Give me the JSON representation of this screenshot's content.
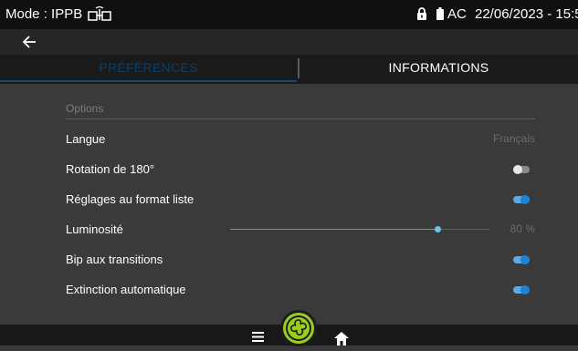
{
  "status_bar": {
    "mode_label": "Mode : IPPB",
    "power_label": "AC",
    "datetime": "22/06/2023 - 15:5",
    "icons": [
      "mode-device-icon",
      "lock-icon",
      "battery-icon"
    ]
  },
  "nav": {
    "back_icon": "back-arrow-icon"
  },
  "tabs": [
    {
      "label": "PRÉFÉRENCES",
      "active": true
    },
    {
      "label": "INFORMATIONS",
      "active": false
    }
  ],
  "options": {
    "section_title": "Options",
    "rows": [
      {
        "label": "Langue",
        "value": "Français",
        "kind": "value"
      },
      {
        "label": "Rotation de 180°",
        "kind": "toggle",
        "on": false
      },
      {
        "label": "Réglages au format liste",
        "kind": "toggle",
        "on": true
      },
      {
        "label": "Luminosité",
        "kind": "slider",
        "value": 80,
        "value_label": "80 %"
      },
      {
        "label": "Bip aux transitions",
        "kind": "toggle",
        "on": true
      },
      {
        "label": "Extinction automatique",
        "kind": "toggle",
        "on": true
      }
    ]
  },
  "bottom_bar": {
    "icons": [
      "menu-icon",
      "app-logo-icon",
      "home-icon"
    ]
  },
  "colors": {
    "accent": "#1b84d8",
    "active_tab_text": "#0e3e63",
    "background": "#3a3a3a"
  }
}
